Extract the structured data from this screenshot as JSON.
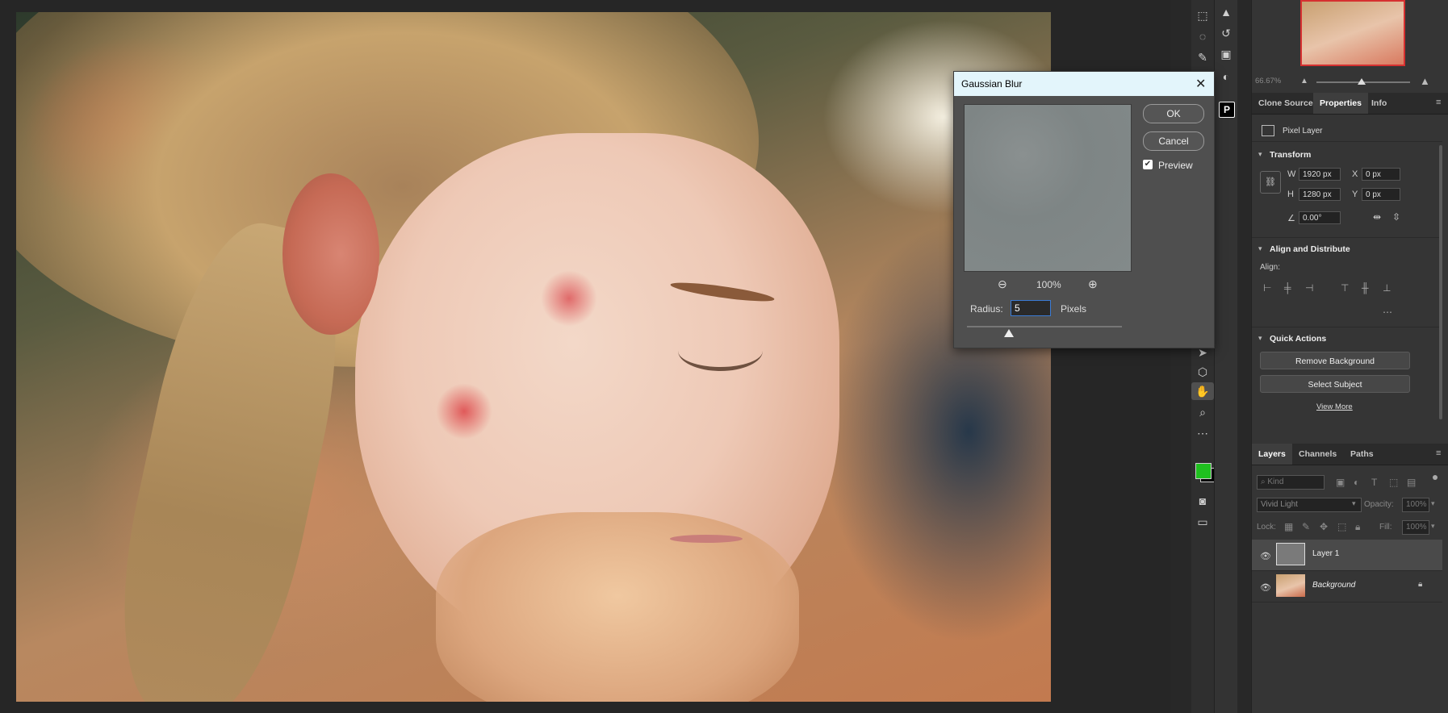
{
  "colors": {
    "accent_blue": "#3a7bd5",
    "foreground_swatch": "#1fc01f",
    "background_swatch": "#000000",
    "dialog_title_bg": "#e3f5fb"
  },
  "navigator": {
    "zoom": "66.67%"
  },
  "panel_tabs": {
    "clone_source": "Clone Source",
    "properties": "Properties",
    "info": "Info"
  },
  "properties": {
    "layer_kind": "Pixel Layer",
    "transform": {
      "title": "Transform",
      "w_label": "W",
      "w_value": "1920 px",
      "h_label": "H",
      "h_value": "1280 px",
      "x_label": "X",
      "x_value": "0 px",
      "y_label": "Y",
      "y_value": "0 px",
      "angle_value": "0.00°"
    },
    "align": {
      "title": "Align and Distribute",
      "align_label": "Align:"
    },
    "quick_actions": {
      "title": "Quick Actions",
      "remove_bg": "Remove Background",
      "select_subject": "Select Subject",
      "view_more": "View More"
    }
  },
  "layers_panel": {
    "tabs": {
      "layers": "Layers",
      "channels": "Channels",
      "paths": "Paths"
    },
    "filter_kind": "Kind",
    "blend_mode": "Vivid Light",
    "opacity_label": "Opacity:",
    "opacity_value": "100%",
    "lock_label": "Lock:",
    "fill_label": "Fill:",
    "fill_value": "100%",
    "layers": [
      {
        "name": "Layer 1"
      },
      {
        "name": "Background"
      }
    ]
  },
  "dialog": {
    "title": "Gaussian Blur",
    "ok": "OK",
    "cancel": "Cancel",
    "preview_label": "Preview",
    "preview_checked": true,
    "zoom": "100%",
    "radius_label": "Radius:",
    "radius_value": "5",
    "radius_unit": "Pixels",
    "radius_slider_level": 0.27
  }
}
